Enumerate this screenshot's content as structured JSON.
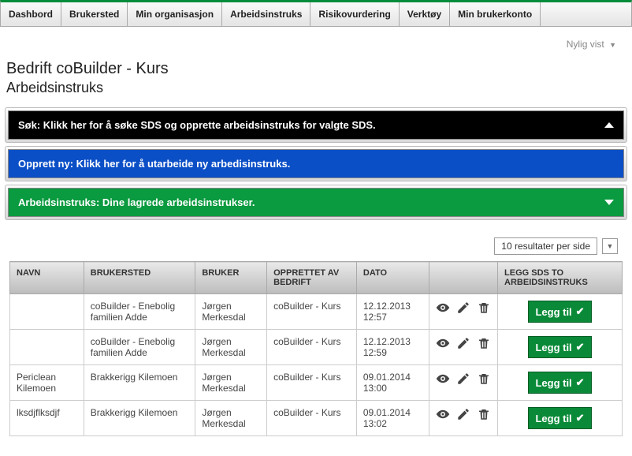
{
  "nav": [
    "Dashbord",
    "Brukersted",
    "Min organisasjon",
    "Arbeidsinstruks",
    "Risikovurdering",
    "Verktøy",
    "Min brukerkonto"
  ],
  "recent": "Nylig vist",
  "title": "Bedrift coBuilder - Kurs",
  "subtitle": "Arbeidsinstruks",
  "bars": {
    "search": "Søk: Klikk her for å søke SDS og opprette arbeidsinstruks for valgte SDS.",
    "create": "Opprett ny: Klikk her for å utarbeide ny arbedisinstruks.",
    "list": "Arbeidsinstruks: Dine lagrede arbeidsinstrukser."
  },
  "pager": {
    "label": "10 resultater per side"
  },
  "columns": {
    "name": "NAVN",
    "site": "BRUKERSTED",
    "user": "BRUKER",
    "created_by": "OPPRETTET AV BEDRIFT",
    "date": "DATO",
    "actions_blank": "",
    "add_sds": "LEGG SDS TO ARBEIDSINSTRUKS"
  },
  "add_label": "Legg til",
  "rows": [
    {
      "name": "",
      "site": "coBuilder - Enebolig familien Adde",
      "user": "Jørgen Merkesdal",
      "created_by": "coBuilder - Kurs",
      "date": "12.12.2013 12:57"
    },
    {
      "name": "",
      "site": "coBuilder - Enebolig familien Adde",
      "user": "Jørgen Merkesdal",
      "created_by": "coBuilder - Kurs",
      "date": "12.12.2013 12:59"
    },
    {
      "name": "Periclean Kilemoen",
      "site": "Brakkerigg Kilemoen",
      "user": "Jørgen Merkesdal",
      "created_by": "coBuilder - Kurs",
      "date": "09.01.2014 13:00"
    },
    {
      "name": "lksdjflksdjf",
      "site": "Brakkerigg Kilemoen",
      "user": "Jørgen Merkesdal",
      "created_by": "coBuilder - Kurs",
      "date": "09.01.2014 13:02"
    }
  ]
}
